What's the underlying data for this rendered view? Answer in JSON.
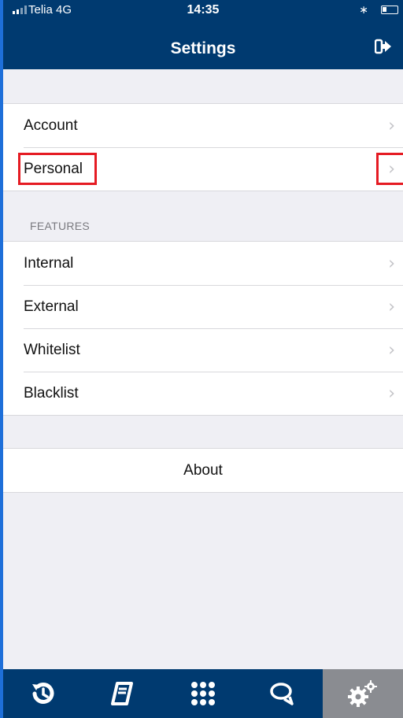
{
  "status_bar": {
    "carrier": "Telia  4G",
    "time": "14:35"
  },
  "nav": {
    "title": "Settings"
  },
  "groups": {
    "account_section": [
      {
        "label": "Account"
      },
      {
        "label": "Personal"
      }
    ],
    "features_section": {
      "header": "FEATURES",
      "items": [
        {
          "label": "Internal"
        },
        {
          "label": "External"
        },
        {
          "label": "Whitelist"
        },
        {
          "label": "Blacklist"
        }
      ]
    },
    "about": {
      "label": "About"
    }
  },
  "tab_bar": {
    "tabs": [
      {
        "icon": "recents-icon"
      },
      {
        "icon": "contacts-book-icon"
      },
      {
        "icon": "keypad-icon"
      },
      {
        "icon": "chat-icon"
      },
      {
        "icon": "settings-gears-icon",
        "active": true
      }
    ]
  },
  "colors": {
    "header_bg": "#003a70",
    "highlight": "#e51b23",
    "active_tab": "#8a8c91"
  }
}
